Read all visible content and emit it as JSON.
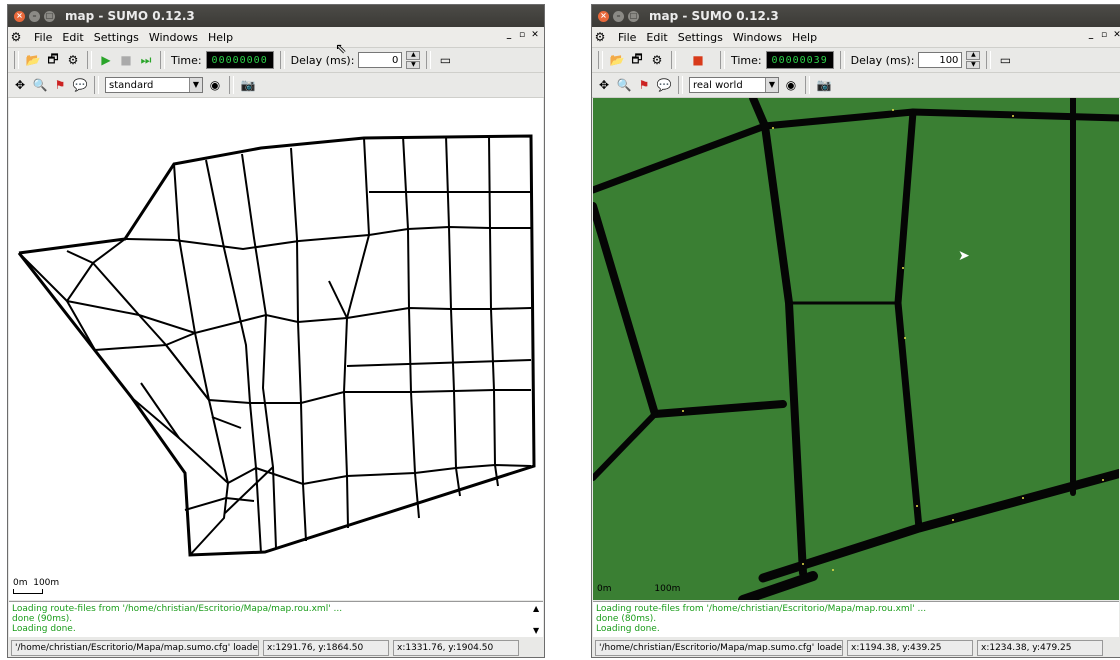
{
  "left": {
    "title": "map - SUMO 0.12.3",
    "menu": [
      "File",
      "Edit",
      "Settings",
      "Windows",
      "Help"
    ],
    "time_display": "00000000",
    "delay_label": "Delay (ms):",
    "delay_value": "0",
    "time_label": "Time:",
    "scheme": "standard",
    "scale_label_0": "0m",
    "scale_label_100": "100m",
    "log": [
      "Loading route-files from '/home/christian/Escritorio/Mapa/map.rou.xml' ...",
      " done (90ms).",
      "Loading done."
    ],
    "status_file": "'/home/christian/Escritorio/Mapa/map.sumo.cfg' loade",
    "status_pos1": "x:1291.76, y:1864.50",
    "status_pos2": "x:1331.76, y:1904.50"
  },
  "right": {
    "title": "map - SUMO 0.12.3",
    "menu": [
      "File",
      "Edit",
      "Settings",
      "Windows",
      "Help"
    ],
    "time_display": "00000039",
    "delay_label": "Delay (ms):",
    "delay_value": "100",
    "time_label": "Time:",
    "scheme": "real world",
    "scale_label_0": "0m",
    "scale_label_100": "100m",
    "log": [
      "Loading route-files from '/home/christian/Escritorio/Mapa/map.rou.xml' ...",
      " done (80ms).",
      "Loading done."
    ],
    "status_file": "'/home/christian/Escritorio/Mapa/map.sumo.cfg' loade",
    "status_pos1": "x:1194.38, y:439.25",
    "status_pos2": "x:1234.38, y:479.25"
  },
  "colors": {
    "green_bg": "#3a7f33",
    "log_text": "#1a9c1a",
    "lcd": "#2dd34a"
  },
  "icons": [
    "open-icon",
    "reload-icon",
    "settings-icon",
    "play-icon",
    "stop-icon",
    "step-icon",
    "locate-icon",
    "zoom-icon",
    "tracker-icon",
    "bubble-icon",
    "palette-icon",
    "snapshot-icon"
  ]
}
